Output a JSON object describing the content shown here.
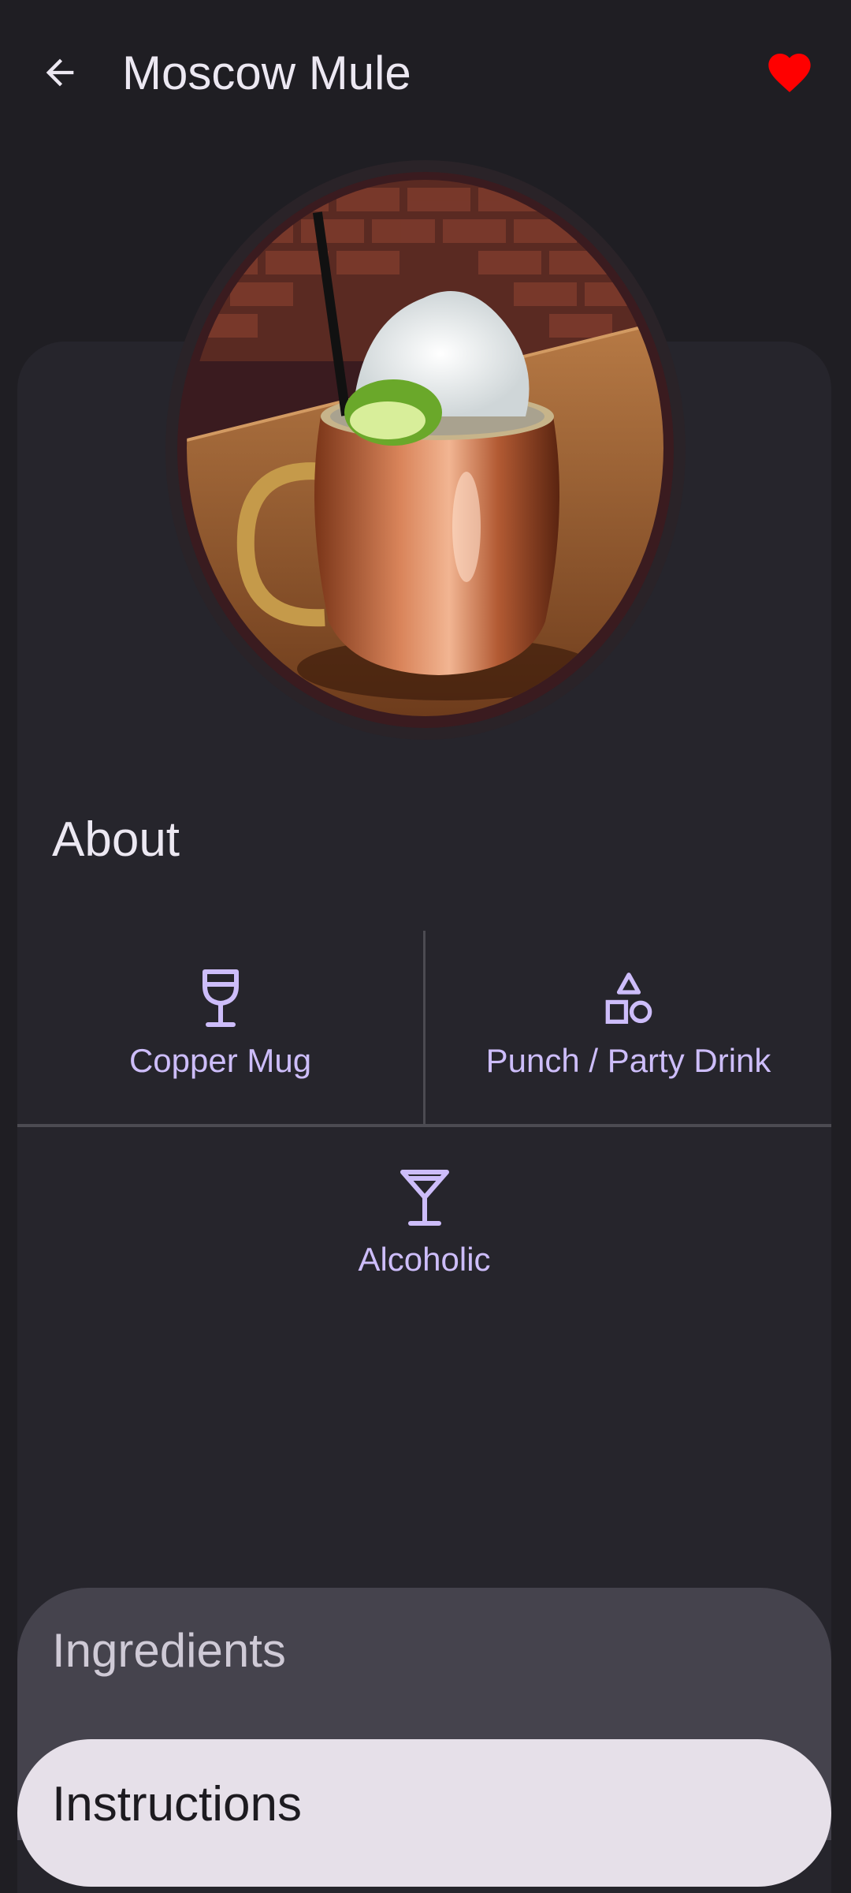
{
  "app_bar": {
    "title": "Moscow Mule",
    "back_icon": "arrow-back-icon",
    "favorite_icon": "heart-filled-icon",
    "favorite_color": "#ff0000"
  },
  "hero": {
    "image_alt": "cocktail-photo"
  },
  "about": {
    "heading": "About",
    "glass": {
      "icon": "wine-glass-icon",
      "label": "Copper Mug"
    },
    "category": {
      "icon": "shapes-icon",
      "label": "Punch / Party Drink"
    },
    "alcoholic": {
      "icon": "cocktail-glass-icon",
      "label": "Alcoholic"
    }
  },
  "tabs": {
    "ingredients_label": "Ingredients",
    "instructions_label": "Instructions"
  },
  "colors": {
    "background": "#1f1e23",
    "card": "#26252c",
    "accent": "#cdbdfa",
    "text_primary": "#ece8f2"
  }
}
